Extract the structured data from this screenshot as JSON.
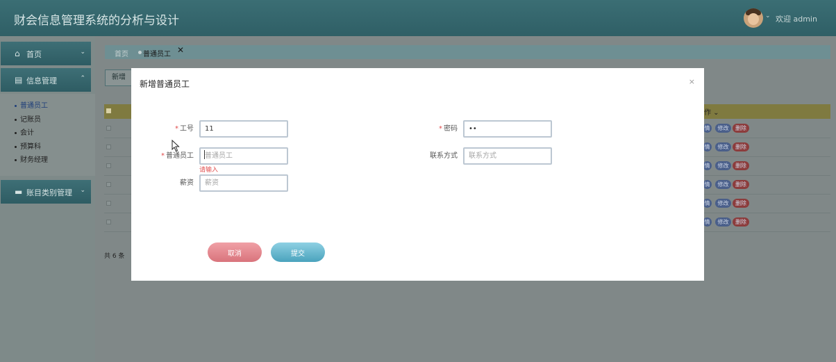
{
  "header": {
    "title": "财会信息管理系统的分析与设计",
    "user_chevron": "⌄",
    "welcome": "欢迎 admin"
  },
  "sidebar": {
    "menus": [
      {
        "icon": "home-icon",
        "label": "首页",
        "arrow": "⌄"
      },
      {
        "icon": "info-icon",
        "label": "信息管理",
        "arrow": "⌃"
      },
      {
        "icon": "account-icon",
        "label": "账目类别管理",
        "arrow": "⌄"
      }
    ],
    "submenu": [
      "普通员工",
      "记账员",
      "会计",
      "预算科",
      "财务经理"
    ],
    "active_submenu": "普通员工"
  },
  "breadcrumb": {
    "home": "首页",
    "current": "普通员工",
    "close": "✕"
  },
  "toolbar": {
    "add_label": "新增"
  },
  "table": {
    "op_header_fragment": "作 ⌄",
    "rows": 6,
    "row_actions": {
      "detail": "情",
      "edit": "修改",
      "delete": "删除"
    }
  },
  "pagination": {
    "total_text": "共 6 条"
  },
  "modal": {
    "title": "新增普通员工",
    "close": "×",
    "fields": {
      "job_no": {
        "label": "工号",
        "required": true,
        "value": "11",
        "placeholder": ""
      },
      "password": {
        "label": "密码",
        "required": true,
        "value": "••",
        "placeholder": ""
      },
      "name": {
        "label": "普通员工",
        "required": true,
        "value": "",
        "placeholder": "普通员工",
        "error": "请输入"
      },
      "contact": {
        "label": "联系方式",
        "required": false,
        "value": "",
        "placeholder": "联系方式"
      },
      "salary": {
        "label": "薪资",
        "required": false,
        "value": "",
        "placeholder": "薪资"
      }
    },
    "cancel_label": "取消",
    "submit_label": "提交"
  },
  "colors": {
    "header_bg": "#2f5f66",
    "overlay": "#7f8b8a",
    "cancel_btn": "#e58a92",
    "submit_btn": "#5fb3cb",
    "table_header": "#7f7a40",
    "error": "#e05050"
  }
}
